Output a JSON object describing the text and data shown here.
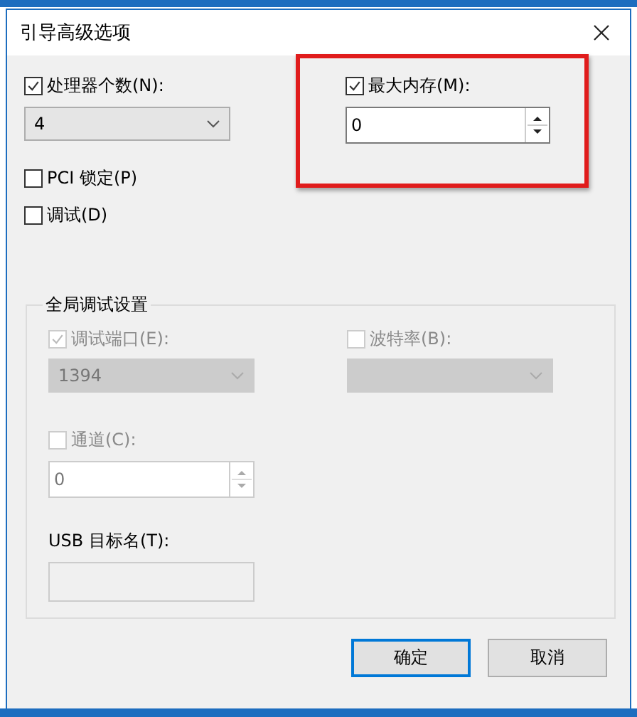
{
  "window": {
    "title": "引导高级选项"
  },
  "processor_count": {
    "label": "处理器个数(N):",
    "checked": true,
    "value": "4"
  },
  "max_memory": {
    "label": "最大内存(M):",
    "checked": true,
    "value": "0",
    "highlighted": true
  },
  "pci_lock": {
    "label": "PCI 锁定(P)",
    "checked": false
  },
  "debug": {
    "label": "调试(D)",
    "checked": false
  },
  "global_debug_settings": {
    "title": "全局调试设置",
    "disabled": true,
    "debug_port": {
      "label": "调试端口(E):",
      "checked": true,
      "value": "1394"
    },
    "baud_rate": {
      "label": "波特率(B):",
      "checked": false
    },
    "channel": {
      "label": "通道(C):",
      "checked": false,
      "value": "0"
    },
    "usb_target_name": {
      "label": "USB 目标名(T):"
    }
  },
  "buttons": [
    {
      "label": "确定",
      "default": true
    },
    {
      "label": "取消",
      "default": false
    }
  ]
}
